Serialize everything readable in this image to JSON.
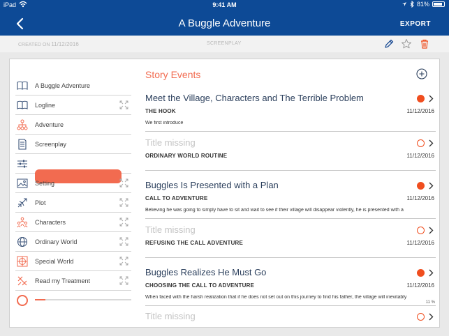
{
  "status_bar": {
    "carrier": "iPad",
    "time": "9:41 AM",
    "battery": "81%"
  },
  "nav": {
    "title": "A Buggle Adventure",
    "export_label": "EXPORT"
  },
  "subbar": {
    "created_label": "CREATED ON",
    "created_date": "11/12/2016",
    "mode": "SCREENPLAY"
  },
  "sidebar": {
    "items": [
      {
        "label": "A Buggle Adventure",
        "icon": "book-icon",
        "expand": false
      },
      {
        "label": "Logline",
        "icon": "book-icon",
        "expand": true
      },
      {
        "label": "Adventure",
        "icon": "hierarchy-icon",
        "expand": false
      },
      {
        "label": "Screenplay",
        "icon": "document-icon",
        "expand": false
      },
      {
        "label": "",
        "icon": "sliders-icon",
        "expand": false
      },
      {
        "label": "Setting",
        "icon": "image-icon",
        "expand": true
      },
      {
        "label": "Plot",
        "icon": "plot-icon",
        "expand": true
      },
      {
        "label": "Characters",
        "icon": "characters-icon",
        "expand": true
      },
      {
        "label": "Ordinary World",
        "icon": "globe-icon",
        "expand": true
      },
      {
        "label": "Special World",
        "icon": "special-world-icon",
        "expand": true
      },
      {
        "label": "Read my Treatment",
        "icon": "treatment-icon",
        "expand": true
      }
    ],
    "progress": {
      "value": 0.11,
      "label": "11 %"
    }
  },
  "panel": {
    "title": "Story Events",
    "events": [
      {
        "title": "Meet the Village, Characters and The Terrible Problem",
        "missing": false,
        "stage": "THE HOOK",
        "date": "11/12/2016",
        "desc": "We first introduce",
        "status": "filled"
      },
      {
        "title": "Title missing",
        "missing": true,
        "stage": "ORDINARY WORLD ROUTINE",
        "date": "11/12/2016",
        "desc": "",
        "status": "hollow"
      },
      {
        "title": "Buggles Is Presented with a Plan",
        "missing": false,
        "stage": "CALL TO ADVENTURE",
        "date": "11/12/2016",
        "desc": "Believing he was going to simply have to sit and wait to see if their village will disappear violently, he is presented with a",
        "status": "filled"
      },
      {
        "title": "Title missing",
        "missing": true,
        "stage": "REFUSING THE CALL ADVENTURE",
        "date": "11/12/2016",
        "desc": "",
        "status": "hollow"
      },
      {
        "title": "Buggles Realizes He Must Go",
        "missing": false,
        "stage": "CHOOSING THE CALL TO ADVENTURE",
        "date": "11/12/2016",
        "desc": "When faced with the harsh realization that if he does not set out on this journey to find his father, the village will inevitably",
        "status": "filled"
      },
      {
        "title": "Title missing",
        "missing": true,
        "stage": "",
        "date": "",
        "desc": "",
        "status": "hollow"
      }
    ]
  },
  "colors": {
    "nav": "#0d4a96",
    "accent": "#f26b50",
    "status_dot": "#f04e1f"
  }
}
